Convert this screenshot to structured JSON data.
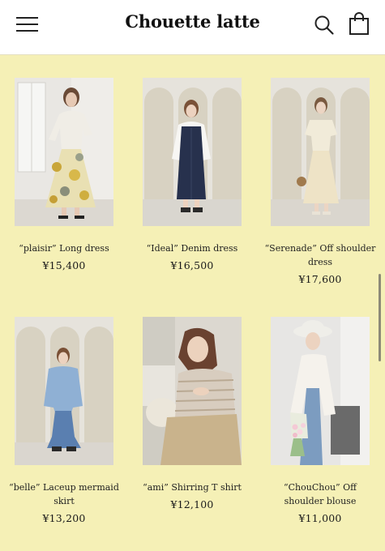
{
  "header": {
    "brand": "Chouette latte",
    "menu_icon": "hamburger-menu-icon",
    "search_icon": "search-icon",
    "cart_icon": "shopping-bag-icon"
  },
  "products": [
    {
      "name": "“plaisir” Long dress",
      "price": "¥15,400",
      "photo": "woman in floral long dress by window"
    },
    {
      "name": "“Ideal” Denim dress",
      "price": "¥16,500",
      "photo": "woman in navy denim dress with white blouse"
    },
    {
      "name": "“Serenade” Off shoulder dress",
      "price": "¥17,600",
      "photo": "woman in beige off shoulder dress"
    },
    {
      "name": "“belle” Laceup mermaid skirt",
      "price": "¥13,200",
      "photo": "woman in light blue sweater and denim mermaid skirt"
    },
    {
      "name": "“ami” Shirring T shirt",
      "price": "¥12,100",
      "photo": "woman in striped cutout t-shirt and beige skirt"
    },
    {
      "name": "“ChouChou” Off shoulder blouse",
      "price": "¥11,000",
      "photo": "woman in white blouse and hat holding flowers"
    }
  ],
  "colors": {
    "page_background": "#f5f0b6",
    "header_background": "#ffffff"
  }
}
